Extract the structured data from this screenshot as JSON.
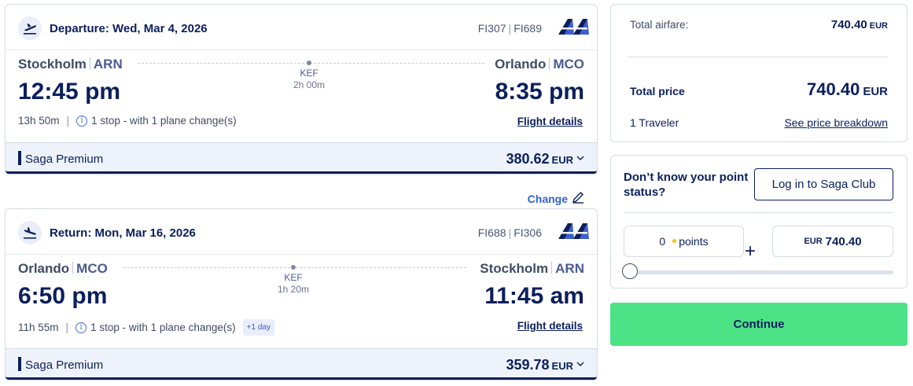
{
  "departure": {
    "title": "Departure: Wed, Mar 4, 2026",
    "flight_code_1": "FI307",
    "flight_code_2": "FI689",
    "origin_city": "Stockholm",
    "origin_code": "ARN",
    "dest_city": "Orlando",
    "dest_code": "MCO",
    "stop_code": "KEF",
    "stop_duration": "2h 00m",
    "depart_time": "12:45 pm",
    "arrive_time": "8:35 pm",
    "duration": "13h 50m",
    "stops_text": "1 stop - with 1 plane change(s)",
    "details_link": "Flight details",
    "fare_name": "Saga Premium",
    "fare_price": "380.62",
    "fare_currency": "EUR"
  },
  "change_label": "Change",
  "return": {
    "title": "Return: Mon, Mar 16, 2026",
    "flight_code_1": "FI688",
    "flight_code_2": "FI306",
    "origin_city": "Orlando",
    "origin_code": "MCO",
    "dest_city": "Stockholm",
    "dest_code": "ARN",
    "stop_code": "KEF",
    "stop_duration": "1h 20m",
    "depart_time": "6:50 pm",
    "arrive_time": "11:45 am",
    "duration": "11h 55m",
    "stops_text": "1 stop - with 1 plane change(s)",
    "plus_day": "+1 day",
    "details_link": "Flight details",
    "fare_name": "Saga Premium",
    "fare_price": "359.78",
    "fare_currency": "EUR"
  },
  "summary": {
    "airfare_label": "Total airfare:",
    "airfare_value": "740.40",
    "airfare_currency": "EUR",
    "total_label": "Total price",
    "total_value": "740.40",
    "total_currency": "EUR",
    "travelers": "1 Traveler",
    "breakdown_link": "See price breakdown"
  },
  "points": {
    "question": "Don’t know your point status?",
    "login_button": "Log in to Saga Club",
    "points_value": "0",
    "points_label": "points",
    "plus_sign": "+",
    "cash_currency": "EUR",
    "cash_value": "740.40",
    "slider_fraction": 0
  },
  "continue_label": "Continue",
  "colors": {
    "navy": "#0b1f5c",
    "link_blue": "#2f63d6",
    "continue_green": "#4ce386",
    "fare_bg": "#eef3fb",
    "points_dot": "#f5c318"
  },
  "icons": {
    "departure": "plane-takeoff-icon",
    "return": "plane-landing-icon",
    "info": "info-icon",
    "change": "pencil-icon",
    "fare_toggle": "chevron-down-icon",
    "airline": "icelandair-logo"
  }
}
